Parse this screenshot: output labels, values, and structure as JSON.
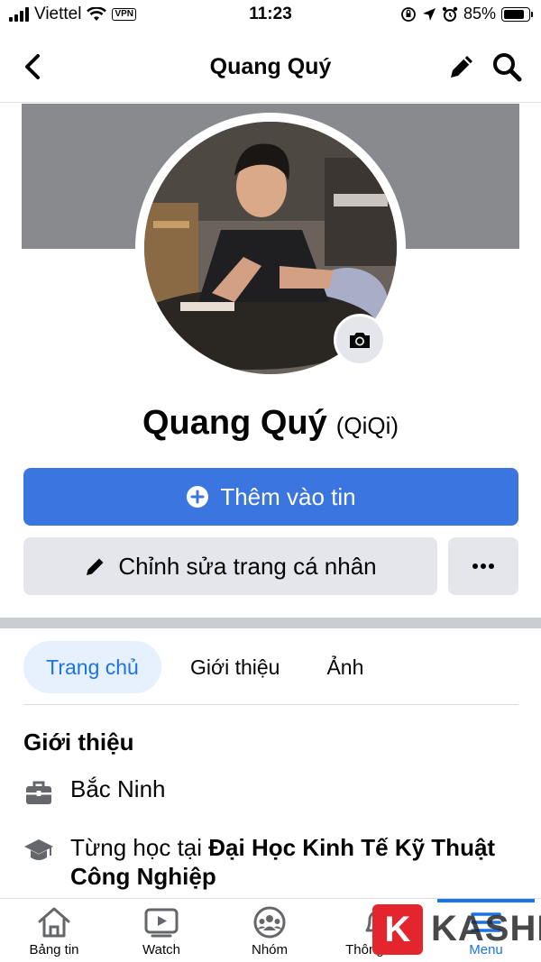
{
  "status_bar": {
    "carrier": "Viettel",
    "vpn": "VPN",
    "time": "11:23",
    "battery": "85%",
    "battery_level": 0.85
  },
  "nav": {
    "title": "Quang Quý",
    "icons": [
      "back-chevron-icon",
      "pencil-icon",
      "search-icon"
    ]
  },
  "profile": {
    "name": "Quang Quý",
    "alt_name": "(QiQi)"
  },
  "actions": {
    "add_story": "Thêm vào tin",
    "edit_profile": "Chỉnh sửa trang cá nhân",
    "more": "..."
  },
  "tabs": [
    {
      "label": "Trang chủ",
      "active": true
    },
    {
      "label": "Giới thiệu",
      "active": false
    },
    {
      "label": "Ảnh",
      "active": false
    }
  ],
  "intro": {
    "title": "Giới thiệu",
    "location": "Bắc Ninh",
    "education_prefix": "Từng học tại ",
    "education_school": "Đại Học Kinh Tế Kỹ Thuật Công Nghiệp"
  },
  "bottom_tabs": [
    {
      "label": "Bảng tin",
      "icon": "home-icon"
    },
    {
      "label": "Watch",
      "icon": "watch-icon"
    },
    {
      "label": "Nhóm",
      "icon": "groups-icon"
    },
    {
      "label": "Thông báo",
      "icon": "bell-icon"
    },
    {
      "label": "Menu",
      "icon": "menu-icon",
      "active": true
    }
  ],
  "watermark": {
    "letter": "K",
    "text": "KASHI"
  },
  "colors": {
    "primary": "#3a75e0",
    "active_blue": "#1b74e4",
    "button_grey": "#e4e6eb",
    "cover_grey": "#888a8d"
  }
}
